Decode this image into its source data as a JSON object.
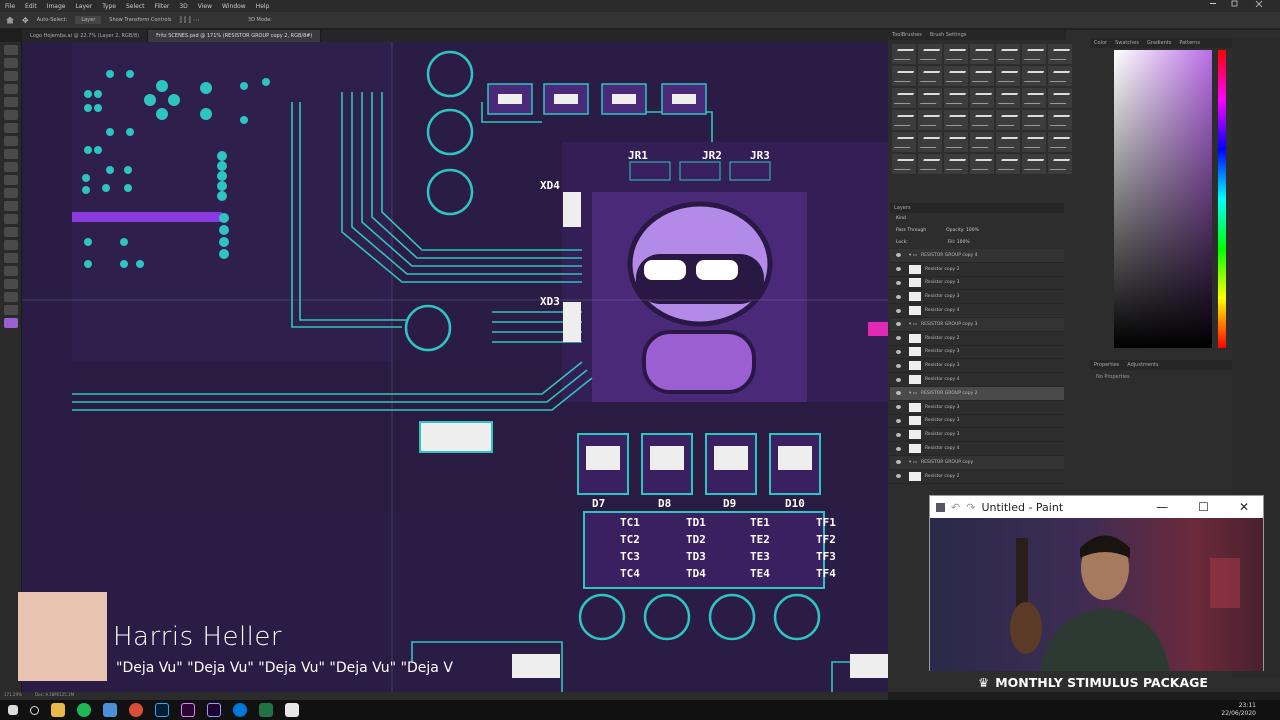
{
  "menu": [
    "File",
    "Edit",
    "Image",
    "Layer",
    "Type",
    "Select",
    "Filter",
    "3D",
    "View",
    "Window",
    "Help"
  ],
  "options": {
    "auto_select": "Auto-Select:",
    "layer": "Layer",
    "transform": "Show Transform Controls",
    "mode": "3D Mode:"
  },
  "tabs": [
    {
      "label": "Logo Hojemba.ai @ 22.7% (Layer 2, RGB/8)",
      "active": false
    },
    {
      "label": "Fritz SCENES.psd @ 171% (RESISTOR GROUP copy 2, RGB/8#)",
      "active": true
    }
  ],
  "pcb_labels": {
    "xd4": "XD4",
    "xd3": "XD3",
    "jr1": "JR1",
    "jr2": "JR2",
    "jr3": "JR3",
    "d7": "D7",
    "d8": "D8",
    "d9": "D9",
    "d10": "D10",
    "tc": [
      "TC1",
      "TC2",
      "TC3",
      "TC4"
    ],
    "td": [
      "TD1",
      "TD2",
      "TD3",
      "TD4"
    ],
    "te": [
      "TE1",
      "TE2",
      "TE3",
      "TE4"
    ],
    "tf": [
      "TF1",
      "TF2",
      "TF3",
      "TF4"
    ]
  },
  "panels": {
    "brushes_tab": "ToolBrushes",
    "brush_settings_tab": "Brush Settings",
    "layers_tab": "Layers",
    "color_tab": "Color",
    "swatches_tab": "Swatches",
    "gradients_tab": "Gradients",
    "patterns_tab": "Patterns",
    "properties_tab": "Properties",
    "adjustments_tab": "Adjustments",
    "no_properties": "No Properties",
    "kind": "Kind",
    "blend": "Pass Through",
    "opacity": "Opacity: 100%",
    "lock": "Lock:",
    "fill": "Fill: 100%"
  },
  "layers": [
    {
      "name": "RESISTOR GROUP copy 4",
      "type": "group"
    },
    {
      "name": "Resistor copy 2",
      "type": "layer"
    },
    {
      "name": "Resistor copy 3",
      "type": "layer"
    },
    {
      "name": "Resistor copy 3",
      "type": "layer"
    },
    {
      "name": "Resistor copy 4",
      "type": "layer"
    },
    {
      "name": "RESISTOR GROUP copy 3",
      "type": "group"
    },
    {
      "name": "Resistor copy 2",
      "type": "layer"
    },
    {
      "name": "Resistor copy 3",
      "type": "layer"
    },
    {
      "name": "Resistor copy 3",
      "type": "layer"
    },
    {
      "name": "Resistor copy 4",
      "type": "layer"
    },
    {
      "name": "RESISTOR GROUP copy 2",
      "type": "selected"
    },
    {
      "name": "Resistor copy 3",
      "type": "layer"
    },
    {
      "name": "Resistor copy 3",
      "type": "layer"
    },
    {
      "name": "Resistor copy 3",
      "type": "layer"
    },
    {
      "name": "Resistor copy 4",
      "type": "layer"
    },
    {
      "name": "RESISTOR GROUP copy",
      "type": "group"
    },
    {
      "name": "Resistor copy 2",
      "type": "layer"
    }
  ],
  "status": {
    "zoom": "171.29%",
    "doc": "Doc: 9.18M/125.1M"
  },
  "paint_window": {
    "title": "Untitled - Paint"
  },
  "overlay": {
    "streamer": "Harris Heller",
    "ticker": "\"Deja Vu\" \"Deja Vu\" \"Deja Vu\" \"Deja Vu\" \"Deja V",
    "banner": "MONTHLY STIMULUS PACKAGE"
  },
  "clock": {
    "time": "23:11",
    "date": "22/06/2020"
  },
  "colors": {
    "pcb_bg": "#2a1a44",
    "trace": "#2ec4c0",
    "purple": "#7a3fc8",
    "magenta": "#e02ab5"
  }
}
